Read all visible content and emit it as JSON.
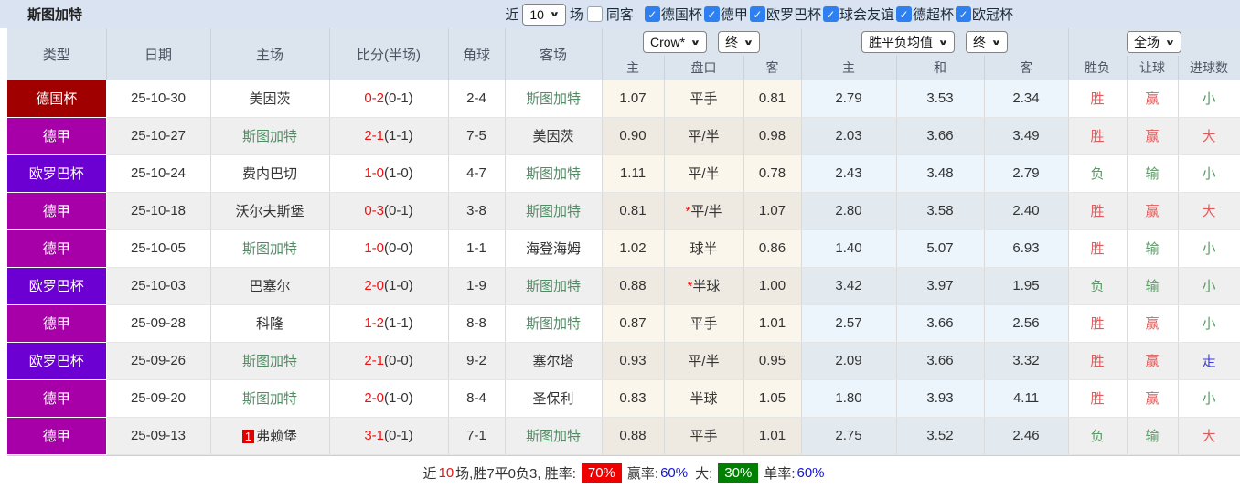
{
  "topbar": {
    "title": "斯图加特",
    "recent_label": "近",
    "recent_count": "10",
    "matches_label": "场",
    "same_opponent": {
      "label": "同客",
      "checked": false
    },
    "competitions": [
      {
        "label": "德国杯",
        "checked": true
      },
      {
        "label": "德甲",
        "checked": true
      },
      {
        "label": "欧罗巴杯",
        "checked": true
      },
      {
        "label": "球会友谊",
        "checked": true
      },
      {
        "label": "德超杯",
        "checked": true
      },
      {
        "label": "欧冠杯",
        "checked": true
      }
    ]
  },
  "table": {
    "headers": {
      "type": "类型",
      "date": "日期",
      "home": "主场",
      "score": "比分(半场)",
      "corner": "角球",
      "away": "客场",
      "odds_company": "Crow*",
      "odds_stage": "终",
      "avg_type": "胜平负均值",
      "avg_stage": "终",
      "scope": "全场",
      "sub": [
        "主",
        "盘口",
        "客",
        "主",
        "和",
        "客",
        "胜负",
        "让球",
        "进球数"
      ]
    },
    "type_colors": {
      "德国杯": "#a00000",
      "德甲": "#a800a8",
      "欧罗巴杯": "#6c00d2"
    },
    "rows": [
      {
        "type": "德国杯",
        "date": "25-10-30",
        "home": "美因茨",
        "home_badge": "",
        "home_green": false,
        "score": "0-2",
        "half": "(0-1)",
        "corner": "2-4",
        "away": "斯图加特",
        "away_green": true,
        "h_odds": "1.07",
        "handicap": "平手",
        "handicap_star": false,
        "a_odds": "0.81",
        "avg_h": "2.79",
        "avg_d": "3.53",
        "avg_a": "2.34",
        "res_wdl": "胜",
        "res_wdl_c": "red",
        "res_ah": "赢",
        "res_ah_c": "red",
        "res_goal": "小",
        "res_goal_c": "green"
      },
      {
        "type": "德甲",
        "date": "25-10-27",
        "home": "斯图加特",
        "home_badge": "",
        "home_green": true,
        "score": "2-1",
        "half": "(1-1)",
        "corner": "7-5",
        "away": "美因茨",
        "away_green": false,
        "h_odds": "0.90",
        "handicap": "平/半",
        "handicap_star": false,
        "a_odds": "0.98",
        "avg_h": "2.03",
        "avg_d": "3.66",
        "avg_a": "3.49",
        "res_wdl": "胜",
        "res_wdl_c": "red",
        "res_ah": "赢",
        "res_ah_c": "red",
        "res_goal": "大",
        "res_goal_c": "red"
      },
      {
        "type": "欧罗巴杯",
        "date": "25-10-24",
        "home": "费内巴切",
        "home_badge": "",
        "home_green": false,
        "score": "1-0",
        "half": "(1-0)",
        "corner": "4-7",
        "away": "斯图加特",
        "away_green": true,
        "h_odds": "1.11",
        "handicap": "平/半",
        "handicap_star": false,
        "a_odds": "0.78",
        "avg_h": "2.43",
        "avg_d": "3.48",
        "avg_a": "2.79",
        "res_wdl": "负",
        "res_wdl_c": "green",
        "res_ah": "输",
        "res_ah_c": "green",
        "res_goal": "小",
        "res_goal_c": "green"
      },
      {
        "type": "德甲",
        "date": "25-10-18",
        "home": "沃尔夫斯堡",
        "home_badge": "",
        "home_green": false,
        "score": "0-3",
        "half": "(0-1)",
        "corner": "3-8",
        "away": "斯图加特",
        "away_green": true,
        "h_odds": "0.81",
        "handicap": "平/半",
        "handicap_star": true,
        "a_odds": "1.07",
        "avg_h": "2.80",
        "avg_d": "3.58",
        "avg_a": "2.40",
        "res_wdl": "胜",
        "res_wdl_c": "red",
        "res_ah": "赢",
        "res_ah_c": "red",
        "res_goal": "大",
        "res_goal_c": "red"
      },
      {
        "type": "德甲",
        "date": "25-10-05",
        "home": "斯图加特",
        "home_badge": "",
        "home_green": true,
        "score": "1-0",
        "half": "(0-0)",
        "corner": "1-1",
        "away": "海登海姆",
        "away_green": false,
        "h_odds": "1.02",
        "handicap": "球半",
        "handicap_star": false,
        "a_odds": "0.86",
        "avg_h": "1.40",
        "avg_d": "5.07",
        "avg_a": "6.93",
        "res_wdl": "胜",
        "res_wdl_c": "red",
        "res_ah": "输",
        "res_ah_c": "green",
        "res_goal": "小",
        "res_goal_c": "green"
      },
      {
        "type": "欧罗巴杯",
        "date": "25-10-03",
        "home": "巴塞尔",
        "home_badge": "",
        "home_green": false,
        "score": "2-0",
        "half": "(1-0)",
        "corner": "1-9",
        "away": "斯图加特",
        "away_green": true,
        "h_odds": "0.88",
        "handicap": "半球",
        "handicap_star": true,
        "a_odds": "1.00",
        "avg_h": "3.42",
        "avg_d": "3.97",
        "avg_a": "1.95",
        "res_wdl": "负",
        "res_wdl_c": "green",
        "res_ah": "输",
        "res_ah_c": "green",
        "res_goal": "小",
        "res_goal_c": "green"
      },
      {
        "type": "德甲",
        "date": "25-09-28",
        "home": "科隆",
        "home_badge": "",
        "home_green": false,
        "score": "1-2",
        "half": "(1-1)",
        "corner": "8-8",
        "away": "斯图加特",
        "away_green": true,
        "h_odds": "0.87",
        "handicap": "平手",
        "handicap_star": false,
        "a_odds": "1.01",
        "avg_h": "2.57",
        "avg_d": "3.66",
        "avg_a": "2.56",
        "res_wdl": "胜",
        "res_wdl_c": "red",
        "res_ah": "赢",
        "res_ah_c": "red",
        "res_goal": "小",
        "res_goal_c": "green"
      },
      {
        "type": "欧罗巴杯",
        "date": "25-09-26",
        "home": "斯图加特",
        "home_badge": "",
        "home_green": true,
        "score": "2-1",
        "half": "(0-0)",
        "corner": "9-2",
        "away": "塞尔塔",
        "away_green": false,
        "h_odds": "0.93",
        "handicap": "平/半",
        "handicap_star": false,
        "a_odds": "0.95",
        "avg_h": "2.09",
        "avg_d": "3.66",
        "avg_a": "3.32",
        "res_wdl": "胜",
        "res_wdl_c": "red",
        "res_ah": "赢",
        "res_ah_c": "red",
        "res_goal": "走",
        "res_goal_c": "blue"
      },
      {
        "type": "德甲",
        "date": "25-09-20",
        "home": "斯图加特",
        "home_badge": "",
        "home_green": true,
        "score": "2-0",
        "half": "(1-0)",
        "corner": "8-4",
        "away": "圣保利",
        "away_green": false,
        "h_odds": "0.83",
        "handicap": "半球",
        "handicap_star": false,
        "a_odds": "1.05",
        "avg_h": "1.80",
        "avg_d": "3.93",
        "avg_a": "4.11",
        "res_wdl": "胜",
        "res_wdl_c": "red",
        "res_ah": "赢",
        "res_ah_c": "red",
        "res_goal": "小",
        "res_goal_c": "green"
      },
      {
        "type": "德甲",
        "date": "25-09-13",
        "home": "弗赖堡",
        "home_badge": "1",
        "home_green": false,
        "score": "3-1",
        "half": "(0-1)",
        "corner": "7-1",
        "away": "斯图加特",
        "away_green": true,
        "h_odds": "0.88",
        "handicap": "平手",
        "handicap_star": false,
        "a_odds": "1.01",
        "avg_h": "2.75",
        "avg_d": "3.52",
        "avg_a": "2.46",
        "res_wdl": "负",
        "res_wdl_c": "green",
        "res_ah": "输",
        "res_ah_c": "green",
        "res_goal": "大",
        "res_goal_c": "red"
      }
    ]
  },
  "footer": {
    "part1": "近",
    "count": "10",
    "part2": "场,胜7平0负3, 胜率:",
    "win_rate": "70%",
    "part3": "赢率:",
    "ah_win_rate": "60%",
    "part4": "大:",
    "big_rate": "30%",
    "part5": "单率:",
    "single_rate": "60%"
  }
}
